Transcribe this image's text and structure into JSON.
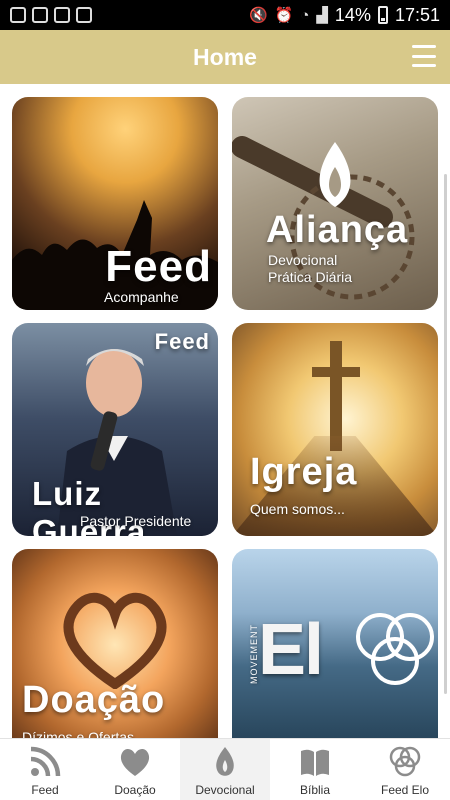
{
  "status_bar": {
    "battery": "14%",
    "time": "17:51"
  },
  "app_bar": {
    "title": "Home"
  },
  "tiles": [
    {
      "title": "Feed",
      "subtitle": "Acompanhe"
    },
    {
      "title": "Aliança",
      "subtitle_line1": "Devocional",
      "subtitle_line2": "Prática Diária"
    },
    {
      "tag": "Feed",
      "title": "Luiz Guerra",
      "subtitle": "Pastor Presidente"
    },
    {
      "title": "Igreja",
      "subtitle": "Quem somos..."
    },
    {
      "title": "Doação",
      "subtitle": "Dízimos e Ofertas"
    },
    {
      "title": "El",
      "vertical_text": "MOVEMENT"
    }
  ],
  "tabs": [
    {
      "label": "Feed",
      "icon": "rss-icon"
    },
    {
      "label": "Doação",
      "icon": "heart-icon"
    },
    {
      "label": "Devocional",
      "icon": "flame-icon"
    },
    {
      "label": "Bíblia",
      "icon": "book-icon"
    },
    {
      "label": "Feed Elo",
      "icon": "rings-icon"
    }
  ],
  "colors": {
    "accent": "#d8c98a",
    "tab_icon": "#8c8c8c"
  }
}
